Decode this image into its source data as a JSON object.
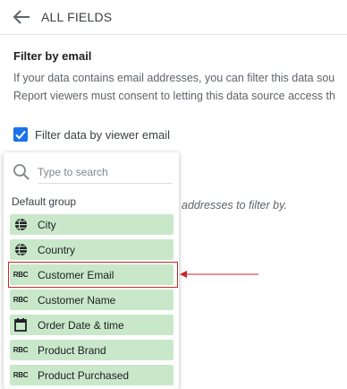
{
  "header": {
    "title": "ALL FIELDS",
    "back_icon": "arrow-back-icon"
  },
  "filter": {
    "title": "Filter by email",
    "description_line1": "If your data contains email addresses, you can filter this data sou",
    "description_line2": "Report viewers must consent to letting this data source access th",
    "checkbox_label": "Filter data by viewer email",
    "checkbox_checked": true,
    "hint": "addresses to filter by."
  },
  "dropdown": {
    "search_placeholder": "Type to search",
    "group_label": "Default group",
    "fields": [
      {
        "label": "City",
        "icon": "globe-icon"
      },
      {
        "label": "Country",
        "icon": "globe-icon"
      },
      {
        "label": "Customer Email",
        "icon": "abc-text-icon",
        "highlighted": true
      },
      {
        "label": "Customer Name",
        "icon": "abc-text-icon"
      },
      {
        "label": "Order Date & time",
        "icon": "calendar-icon"
      },
      {
        "label": "Product Brand",
        "icon": "abc-text-icon"
      },
      {
        "label": "Product Purchased",
        "icon": "abc-text-icon"
      }
    ],
    "abc_glyph": "RBC"
  },
  "colors": {
    "accent": "#1a73e8",
    "field_bg": "#c9e8ca",
    "highlight": "#c62828"
  }
}
